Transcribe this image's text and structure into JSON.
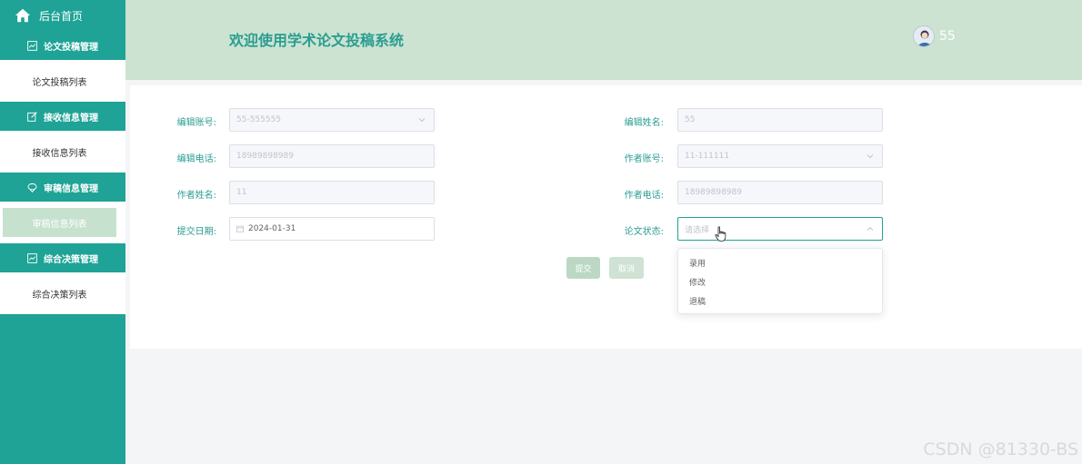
{
  "sidebar": {
    "home_label": "后台首页",
    "groups": [
      {
        "title": "论文投稿管理",
        "item": "论文投稿列表"
      },
      {
        "title": "接收信息管理",
        "item": "接收信息列表"
      },
      {
        "title": "审稿信息管理",
        "item": "审稿信息列表"
      },
      {
        "title": "综合决策管理",
        "item": "综合决策列表"
      }
    ],
    "active_index": 2
  },
  "header": {
    "title": "欢迎使用学术论文投稿系统",
    "username": "55"
  },
  "form": {
    "editor_account_label": "编辑账号:",
    "editor_account_value": "55-555555",
    "editor_name_label": "编辑姓名:",
    "editor_name_value": "55",
    "editor_phone_label": "编辑电话:",
    "editor_phone_value": "18989898989",
    "author_account_label": "作者账号:",
    "author_account_value": "11-111111",
    "author_name_label": "作者姓名:",
    "author_name_value": "11",
    "author_phone_label": "作者电话:",
    "author_phone_value": "18989898989",
    "submit_date_label": "提交日期:",
    "submit_date_value": "2024-01-31",
    "status_label": "论文状态:",
    "status_placeholder": "请选择",
    "submit_button": "提交",
    "cancel_button": "取消"
  },
  "status_options": [
    "录用",
    "修改",
    "退稿"
  ],
  "watermark": "CSDN @81330-BS",
  "colors": {
    "sidebar": "#1ea396",
    "header": "#cce3d1",
    "accent_text": "#2a9d91",
    "active_item": "#c6e2cf"
  }
}
